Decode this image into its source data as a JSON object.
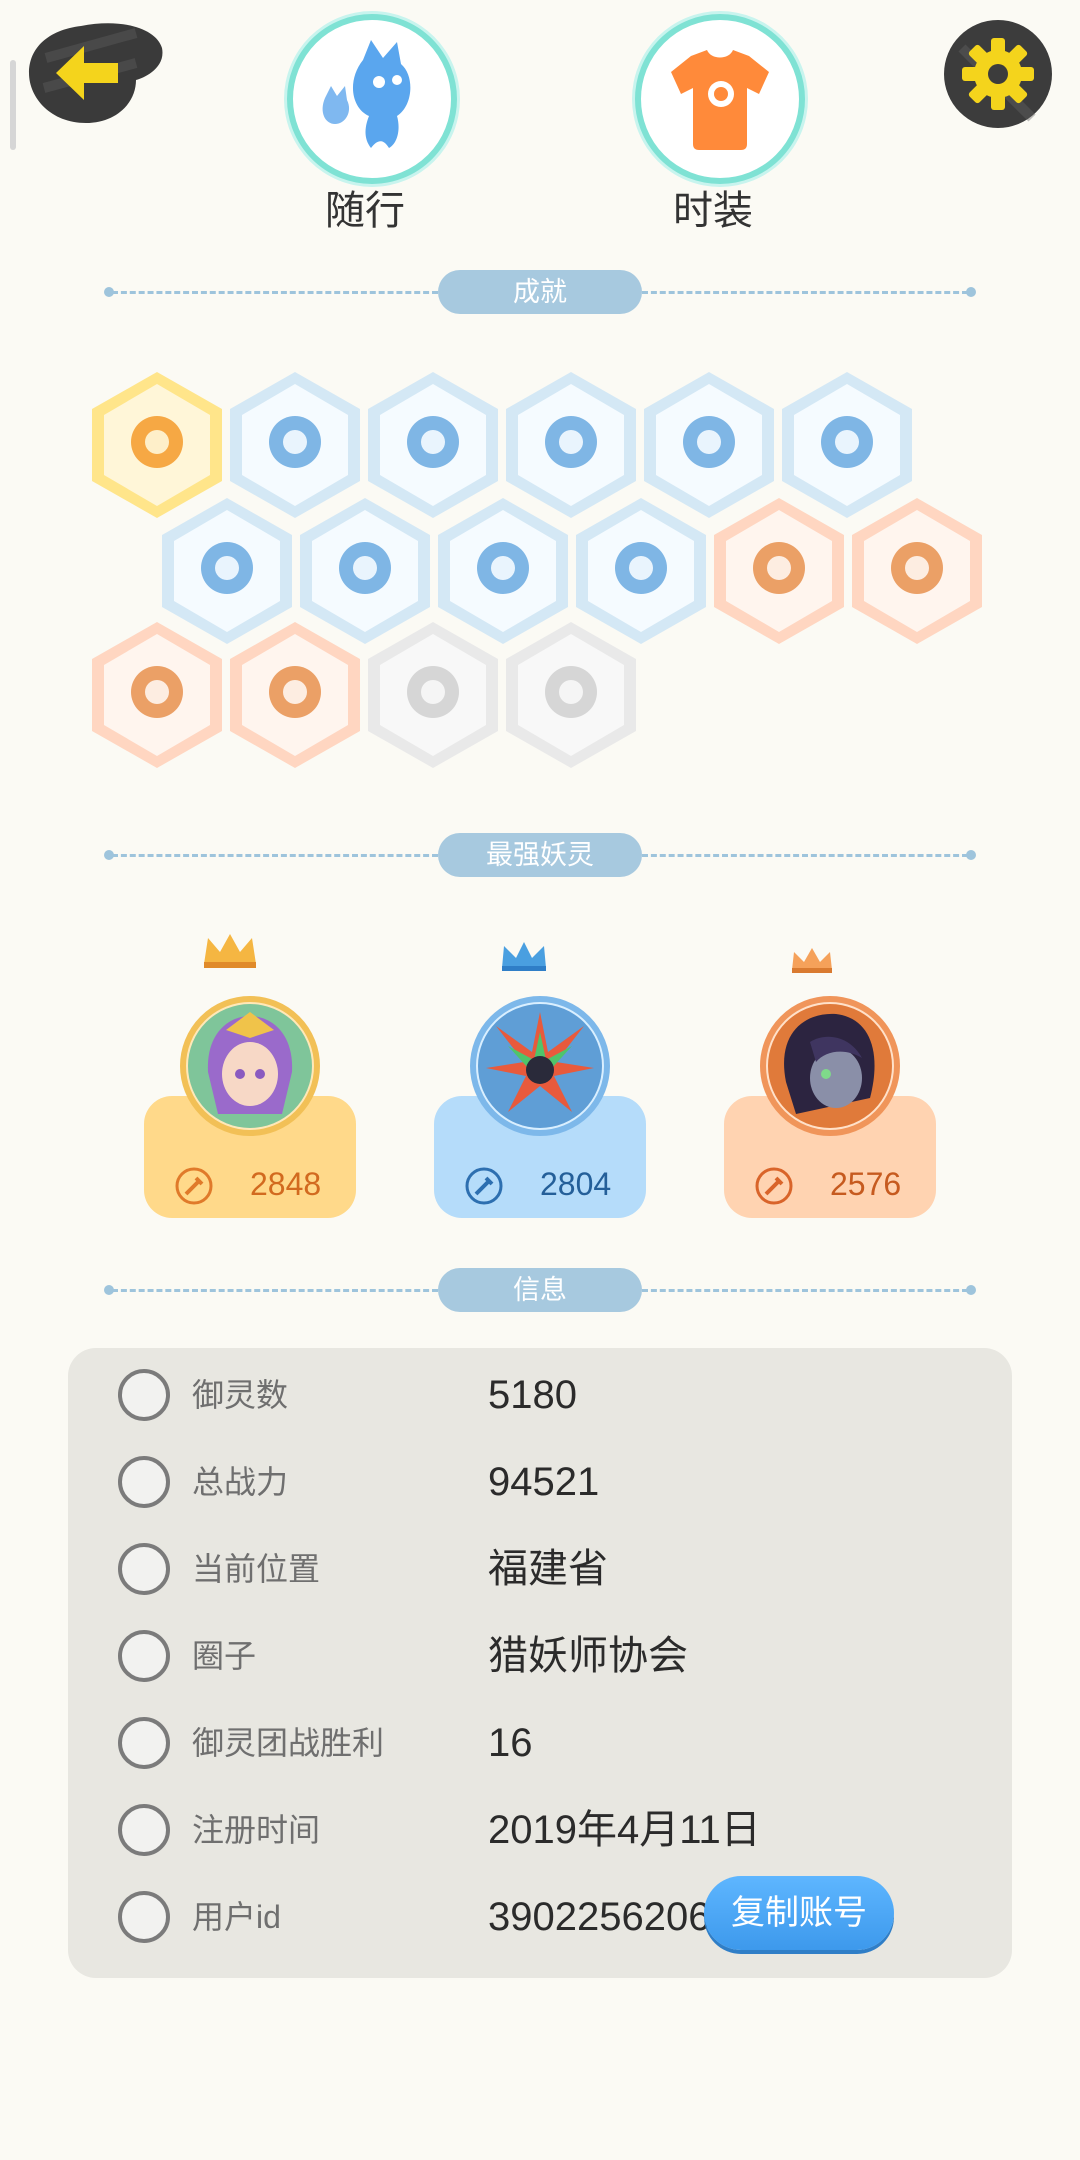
{
  "header": {
    "companion_label": "随行",
    "fashion_label": "时装"
  },
  "sections": {
    "achievements": "成就",
    "strongest": "最强妖灵",
    "info": "信息"
  },
  "achievements": [
    {
      "icon": "fox-face-badge",
      "tier": "gold"
    },
    {
      "icon": "sneaker-badge",
      "tier": "blue"
    },
    {
      "icon": "target-flower-badge",
      "tier": "blue"
    },
    {
      "icon": "crystal-ball-badge",
      "tier": "blue"
    },
    {
      "icon": "wind-yin-yang-badge",
      "tier": "blue"
    },
    {
      "icon": "spirit-statue-badge",
      "tier": "blue"
    },
    {
      "icon": "cat-spirit-badge",
      "tier": "blue"
    },
    {
      "icon": "yin-yang-book-badge",
      "tier": "blue"
    },
    {
      "icon": "scroll-badge",
      "tier": "blue"
    },
    {
      "icon": "open-book-fox-badge",
      "tier": "blue"
    },
    {
      "icon": "moon-sun-badge",
      "tier": "orange"
    },
    {
      "icon": "crystal-egg-badge",
      "tier": "orange"
    },
    {
      "icon": "demon-statue-badge",
      "tier": "orange"
    },
    {
      "icon": "twin-spirits-badge",
      "tier": "orange"
    },
    {
      "icon": "cart-badge",
      "tier": "locked"
    },
    {
      "icon": "dragon-wave-badge",
      "tier": "locked"
    }
  ],
  "champions": [
    {
      "rank": "gold",
      "power": "2848",
      "avatar": "purple-hair-girl"
    },
    {
      "rank": "blue",
      "power": "2804",
      "avatar": "spiky-dragon"
    },
    {
      "rank": "orange",
      "power": "2576",
      "avatar": "dark-hair-girl"
    }
  ],
  "info": [
    {
      "label": "御灵数",
      "value": "5180",
      "icon": "spirit-count-icon"
    },
    {
      "label": "总战力",
      "value": "94521",
      "icon": "sword-icon"
    },
    {
      "label": "当前位置",
      "value": "福建省",
      "icon": "location-pin-icon"
    },
    {
      "label": "圈子",
      "value": "猎妖师协会",
      "icon": "circle-target-icon"
    },
    {
      "label": "御灵团战胜利",
      "value": "16",
      "icon": "trophy-sword-icon"
    },
    {
      "label": "注册时间",
      "value": "2019年4月11日",
      "icon": "clock-icon"
    },
    {
      "label": "用户id",
      "value": "39022562065",
      "icon": "id-card-icon"
    }
  ],
  "copy_button": "复制账号",
  "colors": {
    "gold": "#ffd98a",
    "blue": "#b5dcfa",
    "orange": "#ffd3b1",
    "accent": "#f6d51a"
  }
}
